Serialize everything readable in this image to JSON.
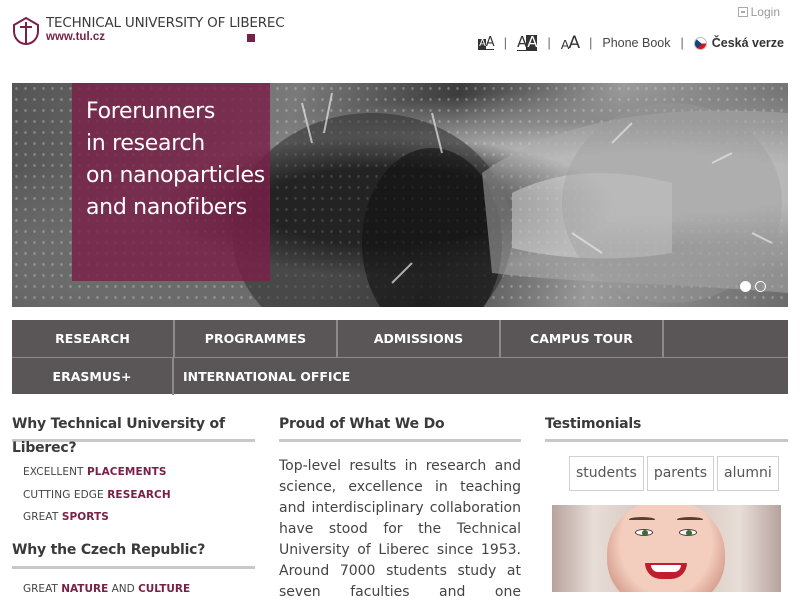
{
  "header": {
    "logo_name": "TECHNICAL UNIVERSITY OF LIBEREC",
    "logo_url": "www.tul.cz",
    "login": "Login",
    "font_sizes": [
      "A",
      "A",
      "A"
    ],
    "phone_book": "Phone Book",
    "language": "Česká verze",
    "accent_color": "#7a2048"
  },
  "hero": {
    "lines": [
      "Forerunners",
      "in research",
      "on nanoparticles",
      "and nanofibers"
    ],
    "slides_total": 2,
    "slide_active": 1
  },
  "nav": {
    "row1": [
      "RESEARCH",
      "PROGRAMMES",
      "ADMISSIONS",
      "CAMPUS TOUR"
    ],
    "row2": [
      "ERASMUS+",
      "INTERNATIONAL OFFICE"
    ]
  },
  "why": {
    "title": "Why Technical University of Liberec?",
    "title_line1": "Why Technical University of",
    "title_line2": "Liberec?",
    "items": [
      {
        "pre": "EXCELLENT",
        "key": "PLACEMENTS"
      },
      {
        "pre": "CUTTING EDGE",
        "key": "RESEARCH"
      },
      {
        "pre": "GREAT",
        "key": "SPORTS"
      }
    ]
  },
  "czech": {
    "title": "Why the Czech Republic?",
    "item1_pre": "GREAT",
    "item1_key1": "NATURE",
    "item1_mid": "AND",
    "item1_key2": "CULTURE"
  },
  "proud": {
    "title": "Proud of What We Do",
    "text": "Top-level results in research and science, excellence in teaching and interdisciplinary collaboration have stood for the Technical University of Liberec since 1953. Around 7000 students study at seven faculties and one specialized institute."
  },
  "testimonials": {
    "title": "Testimonials",
    "tabs": [
      "students",
      "parents",
      "alumni"
    ]
  }
}
